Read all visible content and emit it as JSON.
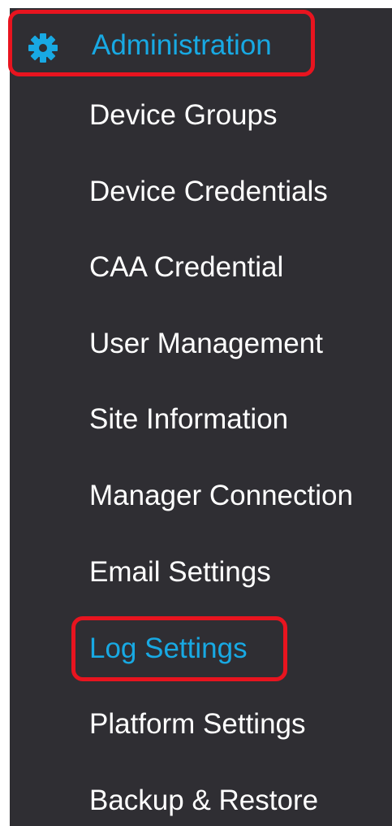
{
  "header": {
    "icon": "gear-icon",
    "label": "Administration"
  },
  "menu": {
    "items": [
      {
        "label": "Device Groups"
      },
      {
        "label": "Device Credentials"
      },
      {
        "label": "CAA Credential"
      },
      {
        "label": "User Management"
      },
      {
        "label": "Site Information"
      },
      {
        "label": "Manager Connection"
      },
      {
        "label": "Email Settings"
      },
      {
        "label": "Log Settings"
      },
      {
        "label": "Platform Settings"
      },
      {
        "label": "Backup & Restore"
      }
    ],
    "active_item": "Log Settings"
  },
  "colors": {
    "sidebar_bg": "#2f2e33",
    "accent": "#18a9e3",
    "highlight": "#e8141f",
    "text": "#ffffff"
  }
}
